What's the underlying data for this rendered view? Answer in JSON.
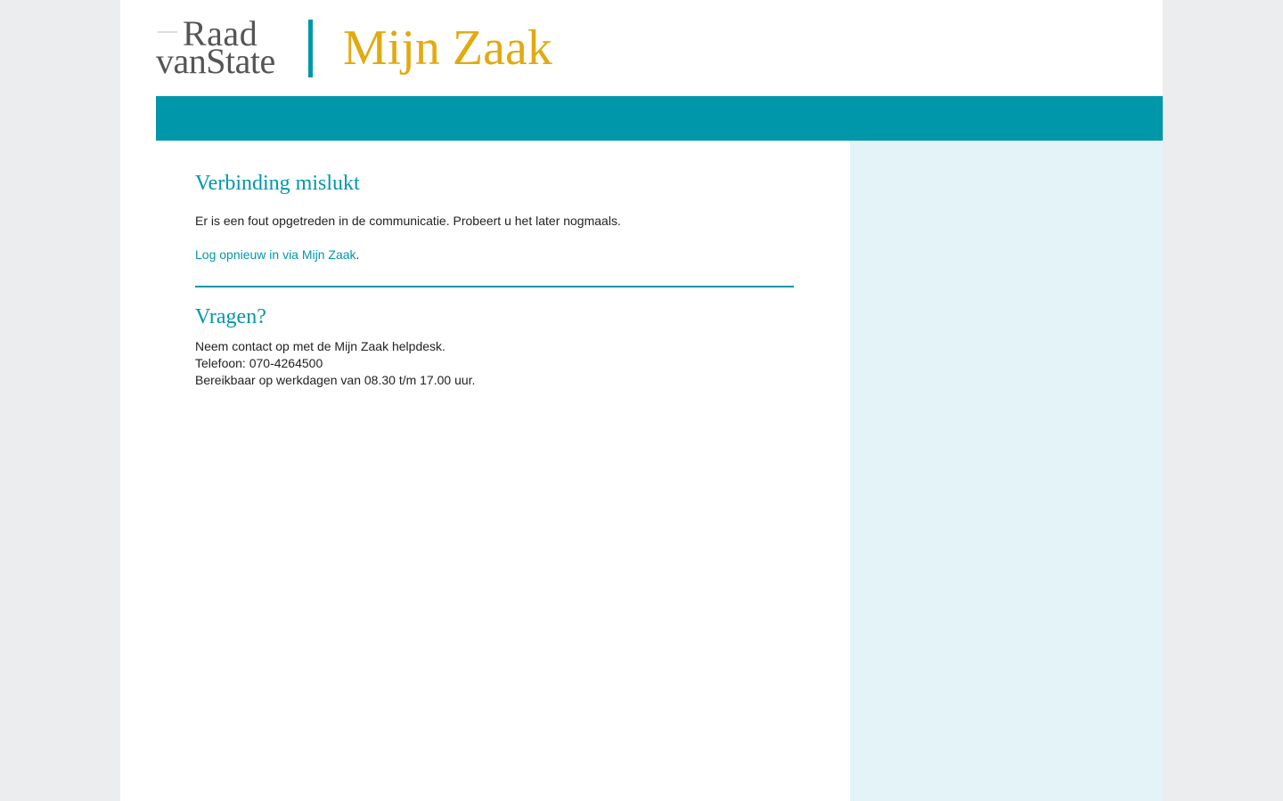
{
  "header": {
    "logo": {
      "line1": "Raad",
      "line2": "vanState"
    },
    "app_title": "Mijn Zaak"
  },
  "main": {
    "error": {
      "heading": "Verbinding mislukt",
      "message": "Er is een fout opgetreden in de communicatie. Probeert u het later nogmaals.",
      "relogin_link": "Log opnieuw in via Mijn Zaak",
      "relogin_suffix": "."
    },
    "questions": {
      "heading": "Vragen?",
      "contact_line": "Neem contact op met de Mijn Zaak helpdesk.",
      "phone_line": "Telefoon: 070-4264500",
      "hours_line": "Bereikbaar op werkdagen van 08.30 t/m 17.00 uur."
    }
  },
  "colors": {
    "brand_teal": "#0197ab",
    "title_gold": "#e1aa10",
    "sidebar_bg": "#e3f3f8",
    "page_bg": "#ebedef"
  }
}
